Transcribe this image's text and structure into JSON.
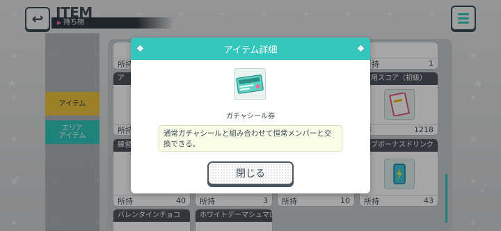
{
  "header": {
    "title": "ITEM",
    "subtitle": "持ち物"
  },
  "sidebar": {
    "tabs": [
      {
        "label": "アイテム",
        "selected": true,
        "color": "#f0c43f"
      },
      {
        "label_line1": "エリア",
        "label_line2": "アイテム",
        "selected": false,
        "color": "#32c9be"
      }
    ]
  },
  "cards": {
    "row0": [
      {
        "count_label": "所持",
        "count": ""
      },
      {
        "count_label": "所持",
        "count": "1"
      }
    ],
    "row1": [
      {
        "name": "ア",
        "count_label": "所持",
        "count": ""
      },
      {
        "name": "習用スコア（初級）",
        "count_label": "持",
        "count": "1218"
      }
    ],
    "row2": [
      {
        "name": "練習",
        "count_label": "所持",
        "count": "40"
      },
      {
        "name": "",
        "count_label": "所持",
        "count": "3"
      },
      {
        "name": "",
        "count_label": "所持",
        "count": "10"
      },
      {
        "name": "イブボーナスドリンク（大）",
        "count_label": "所持",
        "count": "43"
      }
    ],
    "row3": [
      {
        "name": "バレンタインチョコ"
      },
      {
        "name": "ホワイトデーマシュマロ"
      }
    ]
  },
  "dialog": {
    "title": "アイテム詳細",
    "item_name": "ガチャシール券",
    "icon_label": "ガチャシール券",
    "description": "通常ガチャシールと組み合わせて恒常メンバーと交換できる。",
    "close_label": "閉じる"
  },
  "colors": {
    "accent": "#33c6bc",
    "dark": "#3b4a55",
    "item_tab": "#f0c43f"
  }
}
